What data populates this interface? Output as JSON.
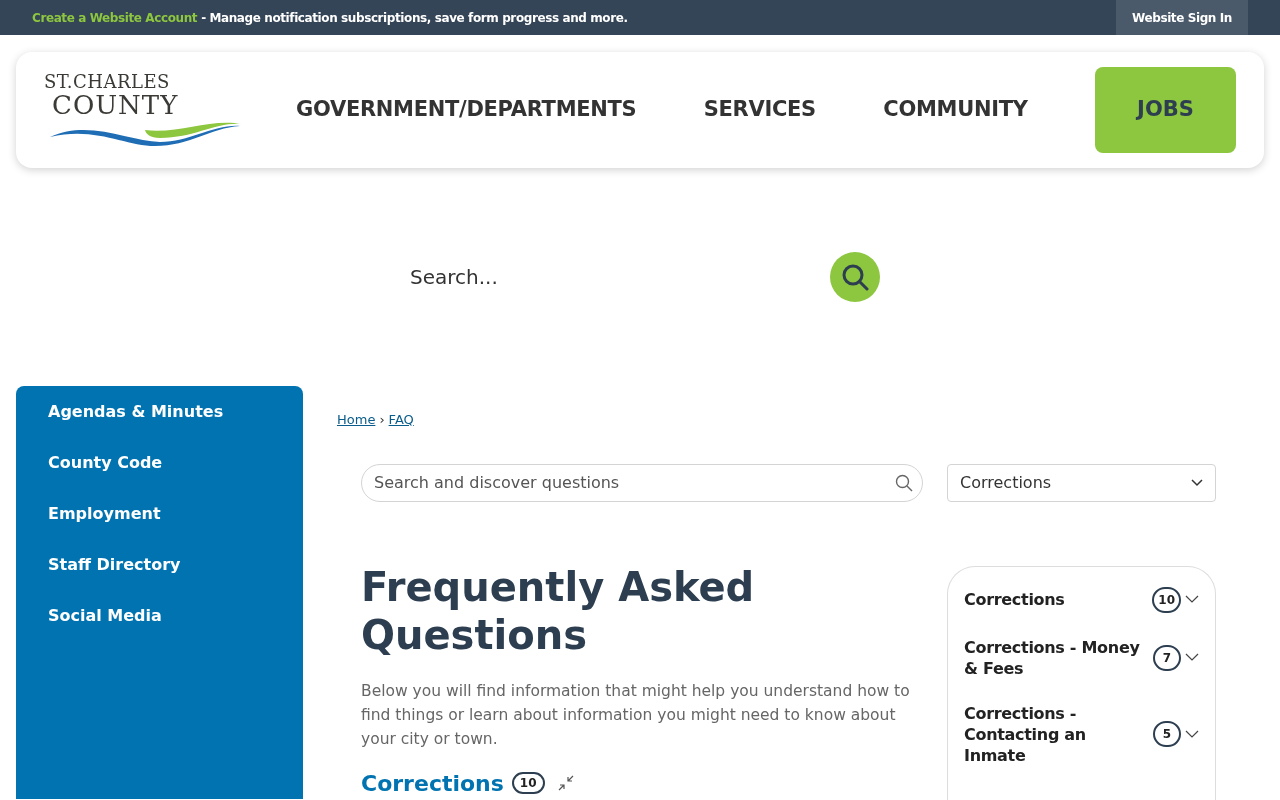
{
  "top_bar": {
    "link": "Create a Website Account",
    "text": "- Manage notification subscriptions, save form progress and more.",
    "sign_in": "Website Sign In"
  },
  "logo": {
    "line_1": "ST.CHARLES",
    "line_2": "COUNTY"
  },
  "nav": [
    {
      "label": "GOVERNMENT/DEPARTMENTS",
      "kind": "link"
    },
    {
      "label": "SERVICES",
      "kind": "link"
    },
    {
      "label": "COMMUNITY",
      "kind": "link"
    },
    {
      "label": "JOBS",
      "kind": "button"
    }
  ],
  "site_search": {
    "placeholder": "Search..."
  },
  "sidebar": {
    "items": [
      "Agendas & Minutes",
      "County Code",
      "Employment",
      "Staff Directory",
      "Social Media"
    ]
  },
  "breadcrumb": [
    "Home",
    "FAQ"
  ],
  "breadcrumb_separator": "›",
  "faq_search": {
    "placeholder": "Search and discover questions"
  },
  "category_select": {
    "value": "Corrections"
  },
  "heading": "Frequently Asked Questions",
  "intro": "Below you will find information that might help you understand how to find things or learn about information you might need to know about your city or town.",
  "section": {
    "title": "Corrections",
    "count": "10"
  },
  "categories": [
    {
      "label": "Corrections",
      "count": "10",
      "expanded": false
    },
    {
      "label": "Corrections - Money & Fees",
      "count": "7",
      "expanded": false
    },
    {
      "label": "Corrections - Contacting an Inmate",
      "count": "5",
      "expanded": false
    }
  ]
}
